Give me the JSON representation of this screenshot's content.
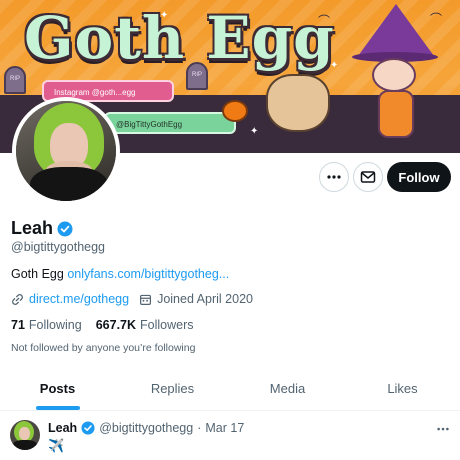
{
  "banner": {
    "title": "Goth Egg",
    "instagram_label": "Instagram @goth...egg",
    "twitter_label": "@BigTittyGothEgg",
    "tombstone_text": "RIP"
  },
  "profile": {
    "name": "Leah",
    "handle": "@bigtittygothegg",
    "bio_prefix": "Goth Egg",
    "bio_link": "onlyfans.com/bigtittygotheg...",
    "website": "direct.me/gothegg",
    "joined": "Joined April 2020",
    "following_count": "71",
    "following_label": "Following",
    "followers_count": "667.7K",
    "followers_label": "Followers",
    "not_followed_text": "Not followed by anyone you’re following"
  },
  "actions": {
    "follow_label": "Follow"
  },
  "tabs": [
    {
      "label": "Posts",
      "active": true
    },
    {
      "label": "Replies",
      "active": false
    },
    {
      "label": "Media",
      "active": false
    },
    {
      "label": "Likes",
      "active": false
    }
  ],
  "tweet": {
    "name": "Leah",
    "handle": "@bigtittygothegg",
    "separator": "·",
    "date": "Mar 17",
    "body": "✈️"
  },
  "colors": {
    "accent": "#1d9bf0",
    "text_primary": "#0f1419",
    "text_secondary": "#536471",
    "follow_button_bg": "#0f1419"
  }
}
